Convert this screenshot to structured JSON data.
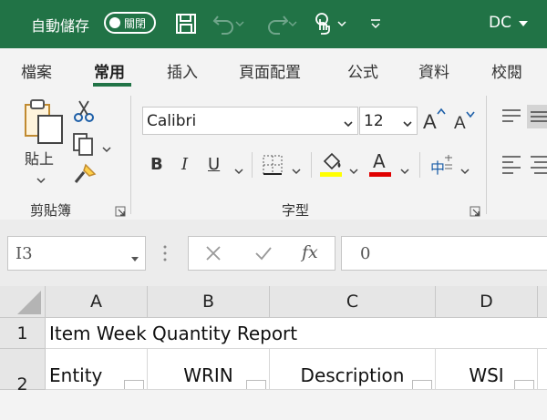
{
  "titlebar": {
    "autosave_label": "自動儲存",
    "toggle_label": "關閉",
    "user_initials": "DC",
    "icons": [
      "save-icon",
      "undo-icon",
      "redo-icon",
      "touch-mode-icon",
      "customize-toolbar-icon",
      "user-menu-caret-icon"
    ]
  },
  "tabs": [
    {
      "label": "檔案"
    },
    {
      "label": "常用",
      "active": true
    },
    {
      "label": "插入"
    },
    {
      "label": "頁面配置"
    },
    {
      "label": "公式"
    },
    {
      "label": "資料"
    },
    {
      "label": "校閱"
    }
  ],
  "ribbon": {
    "clipboard": {
      "group_label": "剪貼簿",
      "paste_label": "貼上"
    },
    "font": {
      "group_label": "字型",
      "font_name": "Calibri",
      "font_size": "12",
      "bold": "B",
      "italic": "I",
      "underline": "U",
      "font_color_letter": "A",
      "phonetic": "中",
      "highlight_color": "#ffff00",
      "font_color": "#e00000"
    }
  },
  "formula_bar": {
    "name_box": "I3",
    "formula_value": "0",
    "fx_label": "fx"
  },
  "sheet": {
    "columns": [
      "A",
      "B",
      "C",
      "D"
    ],
    "rows": [
      "1",
      "2"
    ],
    "cells": {
      "a1": "Item Week Quantity Report",
      "a2": "Entity",
      "b2": "WRIN",
      "c2": "Description",
      "d2": "WSI"
    }
  },
  "colors": {
    "brand_green": "#217346"
  }
}
